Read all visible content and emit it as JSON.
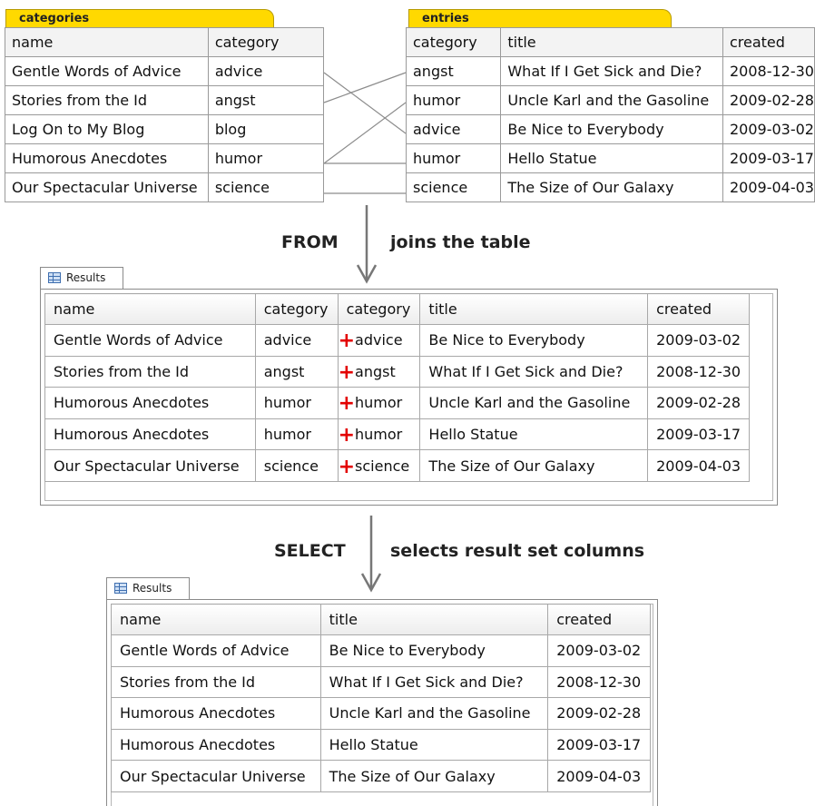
{
  "categories_table": {
    "tab_label": "categories",
    "headers": [
      "name",
      "category"
    ],
    "rows": [
      [
        "Gentle Words of Advice",
        "advice"
      ],
      [
        "Stories from the Id",
        "angst"
      ],
      [
        "Log On to My Blog",
        "blog"
      ],
      [
        "Humorous Anecdotes",
        "humor"
      ],
      [
        "Our Spectacular Universe",
        "science"
      ]
    ]
  },
  "entries_table": {
    "tab_label": "entries",
    "headers": [
      "category",
      "title",
      "created"
    ],
    "rows": [
      [
        "angst",
        "What If I Get Sick and Die?",
        "2008-12-30"
      ],
      [
        "humor",
        "Uncle Karl and the Gasoline",
        "2009-02-28"
      ],
      [
        "advice",
        "Be Nice to Everybody",
        "2009-03-02"
      ],
      [
        "humor",
        "Hello Statue",
        "2009-03-17"
      ],
      [
        "science",
        "The Size of Our Galaxy",
        "2009-04-03"
      ]
    ]
  },
  "from_step": {
    "keyword": "FROM",
    "description": "joins the table"
  },
  "select_step": {
    "keyword": "SELECT",
    "description": "selects result set columns"
  },
  "joined_results": {
    "tab_label": "Results",
    "headers": [
      "name",
      "category",
      "category",
      "title",
      "created"
    ],
    "rows": [
      [
        "Gentle Words of Advice",
        "advice",
        "advice",
        "Be Nice to Everybody",
        "2009-03-02"
      ],
      [
        "Stories from the Id",
        "angst",
        "angst",
        "What If I Get Sick and Die?",
        "2008-12-30"
      ],
      [
        "Humorous Anecdotes",
        "humor",
        "humor",
        "Uncle Karl and the Gasoline",
        "2009-02-28"
      ],
      [
        "Humorous Anecdotes",
        "humor",
        "humor",
        "Hello Statue",
        "2009-03-17"
      ],
      [
        "Our Spectacular Universe",
        "science",
        "science",
        "The Size of Our Galaxy",
        "2009-04-03"
      ]
    ],
    "join_marker": "+",
    "join_marker_color": "#e30000"
  },
  "selected_results": {
    "tab_label": "Results",
    "headers": [
      "name",
      "title",
      "created"
    ],
    "rows": [
      [
        "Gentle Words of Advice",
        "Be Nice to Everybody",
        "2009-03-02"
      ],
      [
        "Stories from the Id",
        "What If I Get Sick and Die?",
        "2008-12-30"
      ],
      [
        "Humorous Anecdotes",
        "Uncle Karl and the Gasoline",
        "2009-02-28"
      ],
      [
        "Humorous Anecdotes",
        "Hello Statue",
        "2009-03-17"
      ],
      [
        "Our Spectacular Universe",
        "The Size of Our Galaxy",
        "2009-04-03"
      ]
    ]
  },
  "colors": {
    "tab_yellow": "#ffd900",
    "arrow_gray": "#777777",
    "plus_red": "#e30000"
  },
  "icons": {
    "results_tab_icon": "grid-icon",
    "flow_arrow": "down-arrow-icon"
  }
}
